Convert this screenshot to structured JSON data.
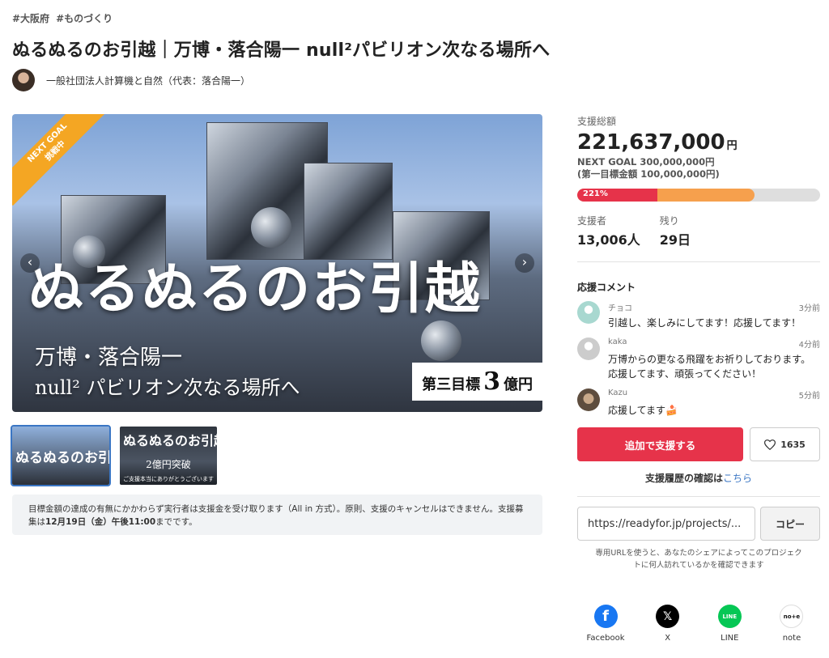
{
  "tags": [
    "#大阪府",
    "#ものづくり"
  ],
  "title": "ぬるぬるのお引越｜万博・落合陽一 null²パビリオン次なる場所へ",
  "owner": "一般社団法人計算機と自然（代表：落合陽一）",
  "hero": {
    "ribbon_line1": "NEXT GOAL",
    "ribbon_line2": "挑戦中",
    "main_text": "ぬるぬるのお引越",
    "sub_line1": "万博・落合陽一",
    "sub_line2": "null² パビリオン次なる場所へ",
    "badge_prefix": "第三目標",
    "badge_number": "3",
    "badge_suffix": "億円",
    "prev_arrow": "‹",
    "next_arrow": "›"
  },
  "thumbnails": [
    {
      "title": "ぬるぬるのお引越",
      "sub": "",
      "bottom": "",
      "active": true
    },
    {
      "title": "ぬるぬるのお引越",
      "sub": "2億円突破",
      "bottom": "ご支援本当にありがとうございます",
      "active": false
    }
  ],
  "notice": {
    "text1": "目標金額の達成の有無にかかわらず実行者は支援金を受け取ります（All in 方式）。原則、支援のキャンセルはできません。支援募集は",
    "deadline": "12月19日（金）午後11:00",
    "text2": "までです。"
  },
  "funding": {
    "label": "支援総額",
    "amount": "221,637,000",
    "currency": "円",
    "next_goal": "NEXT GOAL 300,000,000円",
    "first_goal": "(第一目標金額 100,000,000円)",
    "percent_label": "221%",
    "progress_first": 0.33,
    "progress_next": 0.73
  },
  "stats": {
    "supporters_label": "支援者",
    "supporters_value": "13,006人",
    "remaining_label": "残り",
    "remaining_value": "29日"
  },
  "comments": {
    "title": "応援コメント",
    "items": [
      {
        "name": "チョコ",
        "time": "3分前",
        "text": "引越し、楽しみにしてます！応援してます！",
        "avatar_color": "#a8d8d0"
      },
      {
        "name": "kaka",
        "time": "4分前",
        "text": "万博からの更なる飛躍をお祈りしております。応援してます、頑張ってください！",
        "avatar_color": "#cccccc"
      },
      {
        "name": "Kazu",
        "time": "5分前",
        "text": "応援してます🍰",
        "avatar_color": "#8a7560"
      }
    ]
  },
  "actions": {
    "support_button": "追加で支援する",
    "like_count": "1635",
    "history_text": "支援履歴の確認は",
    "history_link": "こちら"
  },
  "share_url": {
    "value": "https://readyfor.jp/projects/...",
    "copy_button": "コピー",
    "note": "専用URLを使うと、あなたのシェアによってこのプロジェクトに何人訪れているかを確認できます"
  },
  "shares": [
    {
      "label": "Facebook",
      "icon": "facebook-icon",
      "color": "#1877f2",
      "glyph": "f"
    },
    {
      "label": "X",
      "icon": "x-icon",
      "color": "#000000",
      "glyph": "𝕏"
    },
    {
      "label": "LINE",
      "icon": "line-icon",
      "color": "#06c755",
      "glyph": "LINE"
    },
    {
      "label": "note",
      "icon": "note-icon",
      "color": "#ffffff",
      "glyph": "no+e"
    }
  ]
}
